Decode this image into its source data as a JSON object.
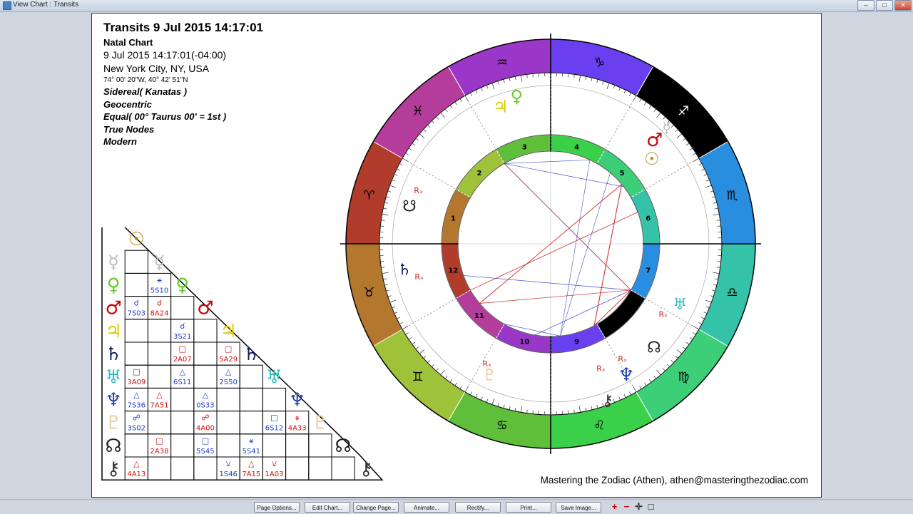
{
  "window": {
    "title": "View Chart : Transits",
    "minimize": "–",
    "maximize": "□",
    "close": "✕"
  },
  "header": {
    "title": "Transits 9 Jul 2015 14:17:01",
    "chart_kind": "Natal Chart",
    "datetime": "9 Jul 2015 14:17:01(-04:00)",
    "location": "New York City, NY, USA",
    "coords": "74° 00' 20\"W, 40° 42' 51\"N",
    "zodiac": "Sidereal( Kanatas )",
    "centric": "Geocentric",
    "houses": "Equal( 00° Taurus 00' = 1st )",
    "nodes": "True Nodes",
    "rulers": "Modern"
  },
  "credit": "Mastering the Zodiac (Athen), athen@masteringthezodiac.com",
  "wheel": {
    "signs": [
      "♈",
      "♉",
      "♊",
      "♋",
      "♌",
      "♍",
      "♎",
      "♏",
      "♐",
      "♑",
      "♒",
      "♓"
    ],
    "sign_colors": [
      "#b23c2c",
      "#b3772e",
      "#9ec23a",
      "#5fbf3a",
      "#3bd04a",
      "#3ccf78",
      "#34c3a8",
      "#2a8ee0",
      "#000000",
      "#6a3ff0",
      "#9a36c8",
      "#b43c9a"
    ],
    "houses": [
      "1",
      "2",
      "3",
      "4",
      "5",
      "6",
      "7",
      "8",
      "9",
      "10",
      "11",
      "12"
    ],
    "planet_glyphs": {
      "saturn": "♄",
      "pluto": "♇",
      "neptune": "♆",
      "chiron": "⚷",
      "node": "☊",
      "south_node": "☋",
      "uranus": "♅",
      "venus": "♀",
      "jupiter": "♃",
      "sun": "☉",
      "mars": "♂",
      "mercury": "☿",
      "retro": "Rₓ"
    }
  },
  "aspect_grid": {
    "planets": [
      {
        "glyph": "☉",
        "color": "#b8860b"
      },
      {
        "glyph": "☿",
        "color": "#bbbbbb"
      },
      {
        "glyph": "♀",
        "color": "#66cc33"
      },
      {
        "glyph": "♂",
        "color": "#cc0000"
      },
      {
        "glyph": "♃",
        "color": "#ddcc00"
      },
      {
        "glyph": "♄",
        "color": "#0a1a66"
      },
      {
        "glyph": "♅",
        "color": "#33bbbb"
      },
      {
        "glyph": "♆",
        "color": "#2244aa"
      },
      {
        "glyph": "♇",
        "color": "#e8c8a0"
      },
      {
        "glyph": "☊",
        "color": "#222222"
      },
      {
        "glyph": "⚷",
        "color": "#333333"
      }
    ],
    "cells": [
      {
        "r": 2,
        "c": 1,
        "sym": "⚹",
        "code": "5S10",
        "col": "#1f3fc8"
      },
      {
        "r": 3,
        "c": 0,
        "sym": "☌",
        "code": "7S03",
        "col": "#1f3fc8"
      },
      {
        "r": 3,
        "c": 1,
        "sym": "☌",
        "code": "8A24",
        "col": "#d01010"
      },
      {
        "r": 4,
        "c": 2,
        "sym": "☌",
        "code": "3S21",
        "col": "#1f3fc8"
      },
      {
        "r": 5,
        "c": 2,
        "sym": "□",
        "code": "2A07",
        "col": "#d01010"
      },
      {
        "r": 5,
        "c": 4,
        "sym": "□",
        "code": "5A29",
        "col": "#d01010"
      },
      {
        "r": 6,
        "c": 0,
        "sym": "□",
        "code": "3A09",
        "col": "#d01010"
      },
      {
        "r": 6,
        "c": 2,
        "sym": "△",
        "code": "6S11",
        "col": "#1f3fc8"
      },
      {
        "r": 6,
        "c": 4,
        "sym": "△",
        "code": "2S50",
        "col": "#1f3fc8"
      },
      {
        "r": 7,
        "c": 0,
        "sym": "△",
        "code": "7S36",
        "col": "#1f3fc8"
      },
      {
        "r": 7,
        "c": 1,
        "sym": "△",
        "code": "7A51",
        "col": "#d01010"
      },
      {
        "r": 7,
        "c": 3,
        "sym": "△",
        "code": "0S33",
        "col": "#1f3fc8"
      },
      {
        "r": 8,
        "c": 0,
        "sym": "☍",
        "code": "3S02",
        "col": "#1f3fc8"
      },
      {
        "r": 8,
        "c": 3,
        "sym": "☍",
        "code": "4A00",
        "col": "#d01010"
      },
      {
        "r": 8,
        "c": 6,
        "sym": "□",
        "code": "6S12",
        "col": "#1f3fc8"
      },
      {
        "r": 8,
        "c": 7,
        "sym": "⚹",
        "code": "4A33",
        "col": "#d01010"
      },
      {
        "r": 9,
        "c": 1,
        "sym": "□",
        "code": "2A38",
        "col": "#d01010"
      },
      {
        "r": 9,
        "c": 3,
        "sym": "□",
        "code": "5S45",
        "col": "#1f3fc8"
      },
      {
        "r": 9,
        "c": 5,
        "sym": "⚹",
        "code": "5S41",
        "col": "#1f3fc8"
      },
      {
        "r": 10,
        "c": 0,
        "sym": "△",
        "code": "4A13",
        "col": "#d01010"
      },
      {
        "r": 10,
        "c": 4,
        "sym": "⚺",
        "code": "1S46",
        "col": "#1f3fc8"
      },
      {
        "r": 10,
        "c": 5,
        "sym": "△",
        "code": "7A15",
        "col": "#d01010"
      },
      {
        "r": 10,
        "c": 6,
        "sym": "⚺",
        "code": "1A03",
        "col": "#d01010"
      }
    ]
  },
  "toolbar": {
    "page_options": "Page Options...",
    "edit_chart": "Edit Chart...",
    "change_page": "Change Page...",
    "animate": "Animate...",
    "rectify": "Rectify...",
    "print": "Print...",
    "save_image": "Save Image...",
    "zoom_in": "+",
    "zoom_out": "−",
    "pan": "✛",
    "fit": "□"
  }
}
